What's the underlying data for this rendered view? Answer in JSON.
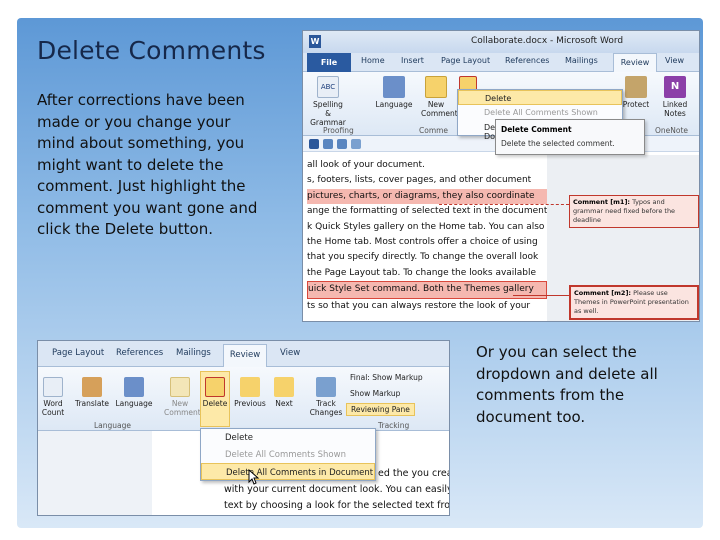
{
  "slide": {
    "title": "Delete Comments",
    "body": "After corrections have been made or you change your mind about something, you might want to delete the comment. Just highlight the comment you want gone and click the Delete button.",
    "body2": "Or you can select the dropdown and delete all comments from the document too."
  },
  "shot1": {
    "window_title": "Collaborate.docx - Microsoft Word",
    "app_icon": "W",
    "tabs": [
      "File",
      "Home",
      "Insert",
      "Page Layout",
      "References",
      "Mailings",
      "Review",
      "View"
    ],
    "ribbon": {
      "spelling": "Spelling & Grammar",
      "language": "Language",
      "new_comment": "New Comment",
      "protect": "Protect",
      "linked_notes": "Linked Notes",
      "groups": [
        "Proofing",
        "Comme",
        "OneNote"
      ]
    },
    "dropdown": {
      "delete": "Delete",
      "delete_all_shown": "Delete All Comments Shown",
      "delete_all_doc": "Delete All Comments in Document"
    },
    "tooltip": {
      "title": "Delete Comment",
      "desc": "Delete the selected comment."
    },
    "doc_lines": [
      "all look of your document.",
      "s, footers, lists, cover pages, and other document",
      "pictures, charts, or diagrams, they also coordinate",
      "ange the formatting of selected text in the document",
      "k Quick Styles gallery on the Home tab. You can also",
      "the Home tab. Most controls offer a choice of using",
      "that you specify directly. To change the overall look",
      "the Page Layout tab. To change the looks available",
      "uick Style Set command. Both the Themes gallery",
      "ts so that you can always restore the look of your"
    ],
    "comment1": {
      "label": "Comment [m1]:",
      "text": "Typos and grammar need fixed before the deadline"
    },
    "comment2": {
      "label": "Comment [m2]:",
      "text": "Please use Themes in PowerPoint presentation as well."
    }
  },
  "shot2": {
    "tabs": [
      "Page Layout",
      "References",
      "Mailings",
      "Review",
      "View"
    ],
    "ribbon": {
      "word_count": "Word Count",
      "translate": "Translate",
      "language": "Language",
      "new_comment": "New Comment",
      "delete": "Delete",
      "previous": "Previous",
      "next": "Next",
      "track_changes": "Track Changes",
      "final_markup": "Final: Show Markup",
      "show_markup": "Show Markup",
      "reviewing_pane": "Reviewing Pane",
      "group_language": "Language",
      "group_tracking": "Tracking"
    },
    "dropdown": {
      "delete": "Delete",
      "delete_all_shown": "Delete All Comments Shown",
      "delete_all_doc": "Delete All Comments in Document"
    },
    "doc_lines": [
      "ed the you create",
      "with your current document look. You can easily c",
      "text by choosing a look for the selected text from"
    ]
  }
}
